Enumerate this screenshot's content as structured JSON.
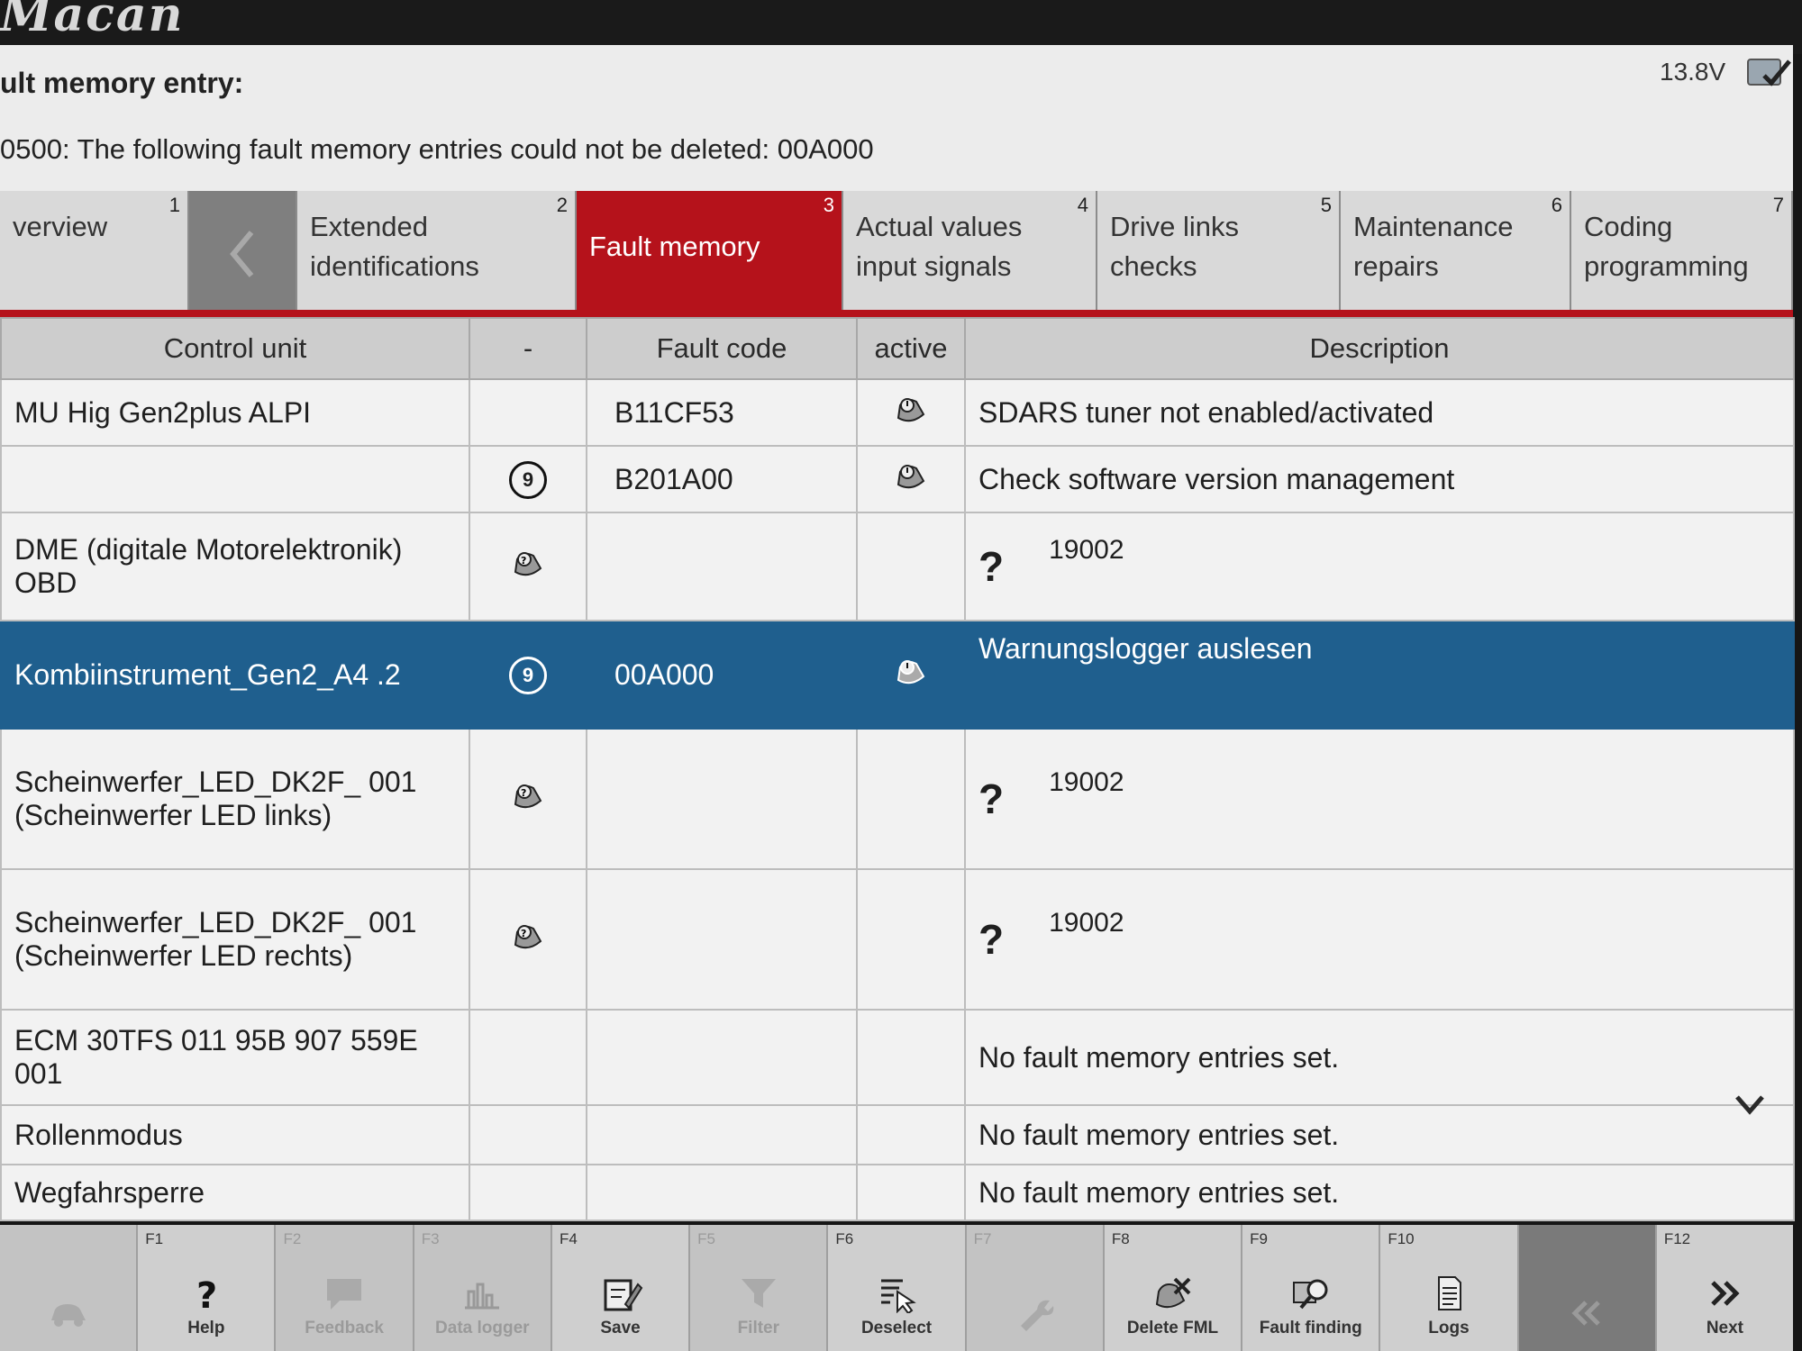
{
  "brand": "Macan",
  "header": {
    "title": "ult memory entry:",
    "message": "0500: The following fault memory entries could not be deleted: 00A000",
    "voltage": "13.8V"
  },
  "tabs": [
    {
      "label": "verview",
      "num": "1"
    },
    {
      "label": "Extended identifications",
      "num": "2"
    },
    {
      "label": "Fault memory",
      "num": "3",
      "active": true
    },
    {
      "label": "Actual values input signals",
      "num": "4"
    },
    {
      "label": "Drive links checks",
      "num": "5"
    },
    {
      "label": "Maintenance repairs",
      "num": "6"
    },
    {
      "label": "Coding programming",
      "num": "7"
    }
  ],
  "table": {
    "headers": {
      "control_unit": "Control unit",
      "marker": "-",
      "fault_code": "Fault code",
      "active": "active",
      "description": "Description"
    },
    "rows": [
      {
        "control_unit": "MU Hig Gen2plus ALPI",
        "badge": "",
        "fault_code": "B11CF53",
        "description": "SDARS tuner not enabled/activated"
      },
      {
        "control_unit": "",
        "badge": "9",
        "fault_code": "B201A00",
        "description": "Check software version management"
      },
      {
        "control_unit": "DME (digitale Motorelektronik) OBD",
        "badge": "",
        "fault_code": "",
        "description": "19002"
      },
      {
        "control_unit": "Kombiinstrument_Gen2_A4 .2",
        "badge": "9",
        "fault_code": "00A000",
        "description": "Warnungslogger auslesen"
      },
      {
        "control_unit": "Scheinwerfer_LED_DK2F_ 001 (Scheinwerfer LED links)",
        "badge": "",
        "fault_code": "",
        "description": "19002"
      },
      {
        "control_unit": "Scheinwerfer_LED_DK2F_ 001 (Scheinwerfer LED rechts)",
        "badge": "",
        "fault_code": "",
        "description": "19002"
      },
      {
        "control_unit": "ECM 30TFS 011 95B 907 559E 001",
        "badge": "",
        "fault_code": "",
        "description": "No fault memory entries set."
      },
      {
        "control_unit": "Rollenmodus",
        "badge": "",
        "fault_code": "",
        "description": "No fault memory entries set."
      },
      {
        "control_unit": "Wegfahrsperre",
        "badge": "",
        "fault_code": "",
        "description": "No fault memory entries set."
      }
    ]
  },
  "function_keys": [
    {
      "fn": "",
      "label": "",
      "icon": "car-icon"
    },
    {
      "fn": "F1",
      "label": "Help",
      "icon": "help-icon"
    },
    {
      "fn": "F2",
      "label": "Feedback",
      "icon": "feedback-icon"
    },
    {
      "fn": "F3",
      "label": "Data logger",
      "icon": "chart-icon"
    },
    {
      "fn": "F4",
      "label": "Save",
      "icon": "save-icon"
    },
    {
      "fn": "F5",
      "label": "Filter",
      "icon": "filter-icon"
    },
    {
      "fn": "F6",
      "label": "Deselect",
      "icon": "deselect-icon"
    },
    {
      "fn": "F7",
      "label": "",
      "icon": "tool-icon"
    },
    {
      "fn": "F8",
      "label": "Delete FML",
      "icon": "delete-fml-icon"
    },
    {
      "fn": "F9",
      "label": "Fault finding",
      "icon": "fault-finding-icon"
    },
    {
      "fn": "F10",
      "label": "Logs",
      "icon": "logs-icon"
    },
    {
      "fn": "",
      "label": "",
      "icon": "back-icon"
    },
    {
      "fn": "F12",
      "label": "Next",
      "icon": "next-icon"
    }
  ]
}
